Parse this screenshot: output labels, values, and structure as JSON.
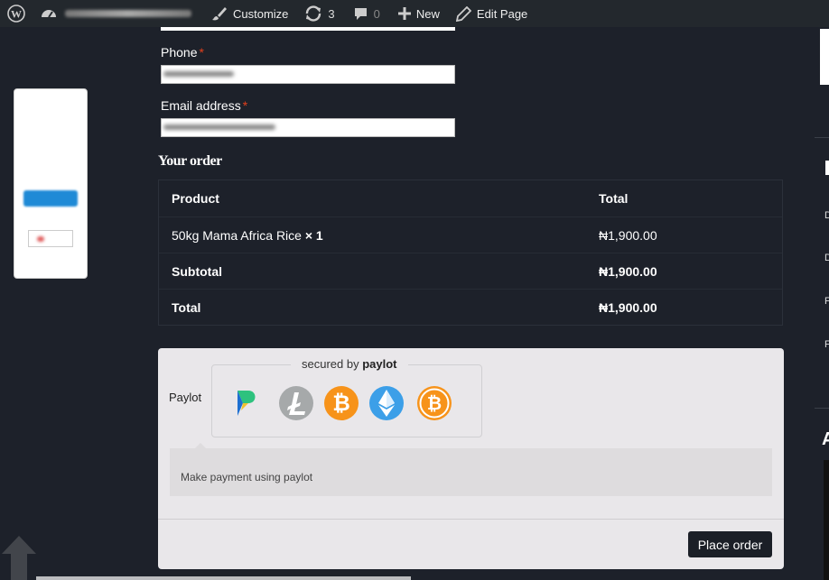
{
  "admin_bar": {
    "customize_label": "Customize",
    "updates_count": "3",
    "comments_count": "0",
    "new_label": "New",
    "edit_page_label": "Edit Page"
  },
  "billing": {
    "phone_label": "Phone",
    "email_label": "Email address",
    "required_mark": "*"
  },
  "order": {
    "heading": "Your order",
    "columns": [
      "Product",
      "Total"
    ],
    "items": [
      {
        "product": "50kg Mama Africa Rice",
        "qty": "× 1",
        "total": "₦1,900.00"
      }
    ],
    "subtotal_label": "Subtotal",
    "subtotal_value": "₦1,900.00",
    "total_label": "Total",
    "total_value": "₦1,900.00"
  },
  "payment": {
    "method_label": "Paylot",
    "secured_prefix": "secured by",
    "secured_brand": "paylot",
    "coins": [
      "paylot-logo-icon",
      "litecoin-icon",
      "bitcoin-icon",
      "ethereum-icon",
      "bitcoin-cash-icon"
    ],
    "description": "Make payment using paylot",
    "place_order_label": "Place order"
  },
  "colors": {
    "page_bg": "#1d212a",
    "admin_bar_bg": "#23282d",
    "required": "#e2401c",
    "payment_bg": "#e9e7ea",
    "button_bg": "#1b1f27",
    "bitcoin_orange": "#f7931a",
    "ethereum_blue": "#3c9fe8",
    "litecoin_gray": "#a6a9aa"
  }
}
